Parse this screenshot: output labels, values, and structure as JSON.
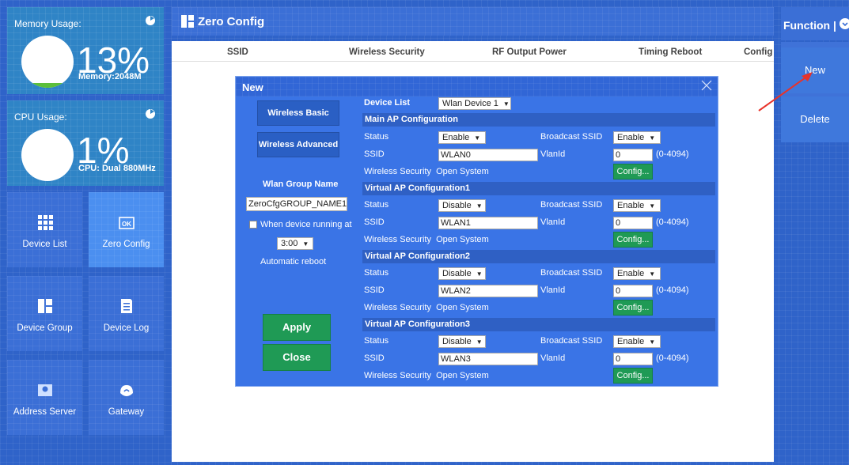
{
  "memory": {
    "title": "Memory Usage:",
    "percent_text": "13%",
    "percent": 13,
    "sub": "Memory:2048M"
  },
  "cpu": {
    "title": "CPU Usage:",
    "percent_text": "1%",
    "percent": 1,
    "sub": "CPU: Dual 880MHz"
  },
  "nav": {
    "device_list": "Device List",
    "zero_config": "Zero Config",
    "device_group": "Device Group",
    "device_log": "Device Log",
    "address_server": "Address Server",
    "gateway": "Gateway"
  },
  "main": {
    "title": "Zero Config",
    "columns": [
      "SSID",
      "Wireless Security",
      "RF Output Power",
      "Timing Reboot",
      "Config"
    ]
  },
  "function_panel": {
    "title": "Function",
    "new_label": "New",
    "delete_label": "Delete"
  },
  "modal": {
    "title": "New",
    "wireless_basic": "Wireless Basic",
    "wireless_advanced": "Wireless Advanced",
    "group_name_label": "Wlan Group Name",
    "group_name_value": "ZeroCfgGROUP_NAME1",
    "when_running_label": "When device running at",
    "reboot_time": "3:00",
    "auto_reboot_label": "Automatic reboot",
    "apply": "Apply",
    "close": "Close",
    "device_list_label": "Device List",
    "device_list_value": "Wlan Device 1",
    "labels": {
      "status": "Status",
      "ssid": "SSID",
      "broadcast_ssid": "Broadcast SSID",
      "vlanid": "VlanId",
      "wireless_security": "Wireless Security",
      "security_value": "Open System",
      "vlan_range": "(0-4094)",
      "config": "Config..."
    },
    "sections": [
      {
        "title": "Main AP Configuration",
        "status": "Enable",
        "broadcast": "Enable",
        "ssid": "WLAN0",
        "vlanid": "0"
      },
      {
        "title": "Virtual AP Configuration1",
        "status": "Disable",
        "broadcast": "Enable",
        "ssid": "WLAN1",
        "vlanid": "0"
      },
      {
        "title": "Virtual AP Configuration2",
        "status": "Disable",
        "broadcast": "Enable",
        "ssid": "WLAN2",
        "vlanid": "0"
      },
      {
        "title": "Virtual AP Configuration3",
        "status": "Disable",
        "broadcast": "Enable",
        "ssid": "WLAN3",
        "vlanid": "0"
      }
    ]
  },
  "colors": {
    "accent_green": "#1f9a55",
    "gauge_green": "#5cbf3a",
    "arrow_red": "#e8332a"
  }
}
